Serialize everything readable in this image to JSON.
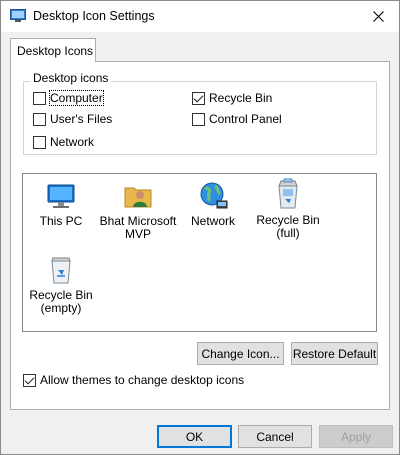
{
  "window": {
    "title": "Desktop Icon Settings",
    "app_icon": "desktop-settings-icon",
    "close_icon": "close-icon"
  },
  "tabs": [
    {
      "label": "Desktop Icons",
      "selected": true
    }
  ],
  "desktop_icons_group": {
    "legend": "Desktop icons",
    "checkboxes": [
      {
        "label": "Computer",
        "checked": false
      },
      {
        "label": "User's Files",
        "checked": false
      },
      {
        "label": "Network",
        "checked": false
      },
      {
        "label": "Recycle Bin",
        "checked": true
      },
      {
        "label": "Control Panel",
        "checked": false
      }
    ]
  },
  "icon_list": [
    {
      "label": "This PC",
      "icon": "this-pc-icon"
    },
    {
      "label": "Bhat Microsoft MVP",
      "icon": "user-folder-icon"
    },
    {
      "label": "Network",
      "icon": "network-globe-icon"
    },
    {
      "label": "Recycle Bin (full)",
      "icon": "recycle-bin-full-icon"
    },
    {
      "label": "Recycle Bin (empty)",
      "icon": "recycle-bin-empty-icon"
    }
  ],
  "buttons": {
    "change_icon": "Change Icon...",
    "restore_default": "Restore Default",
    "ok": "OK",
    "cancel": "Cancel",
    "apply": "Apply"
  },
  "allow_themes": {
    "label": "Allow themes to change desktop icons",
    "checked": true
  },
  "colors": {
    "focus_border": "#0078d7",
    "list_border": "#828790",
    "dialog_bg": "#f0f0f0"
  }
}
